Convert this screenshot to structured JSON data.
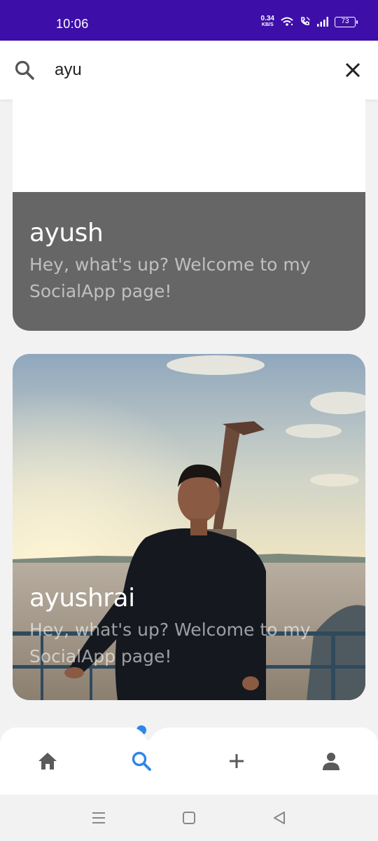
{
  "status_bar": {
    "time": "10:06",
    "net_speed": "0.34",
    "net_unit": "KB/S",
    "battery": "73",
    "icons": [
      "wifi-icon",
      "volte-call-icon",
      "signal-icon",
      "battery-icon"
    ]
  },
  "search": {
    "query": "ayu",
    "icon": "search-icon",
    "clear_icon": "close-icon"
  },
  "results": [
    {
      "name": "ayush",
      "bio": "Hey, what's up? Welcome to my SocialApp page!",
      "has_photo": false
    },
    {
      "name": "ayushrai",
      "bio": "Hey, what's up? Welcome to my SocialApp page!",
      "has_photo": true
    }
  ],
  "bottom_nav": {
    "items": [
      "home-icon",
      "search-icon",
      "add-icon",
      "profile-icon"
    ],
    "active": "search-icon"
  },
  "colors": {
    "status_bar": "#3d0fa8",
    "accent": "#2e86e8",
    "card_overlay": "#666666",
    "nav_icon": "#5a5a5a"
  },
  "system_nav": [
    "menu-icon",
    "home-square-icon",
    "back-icon"
  ]
}
